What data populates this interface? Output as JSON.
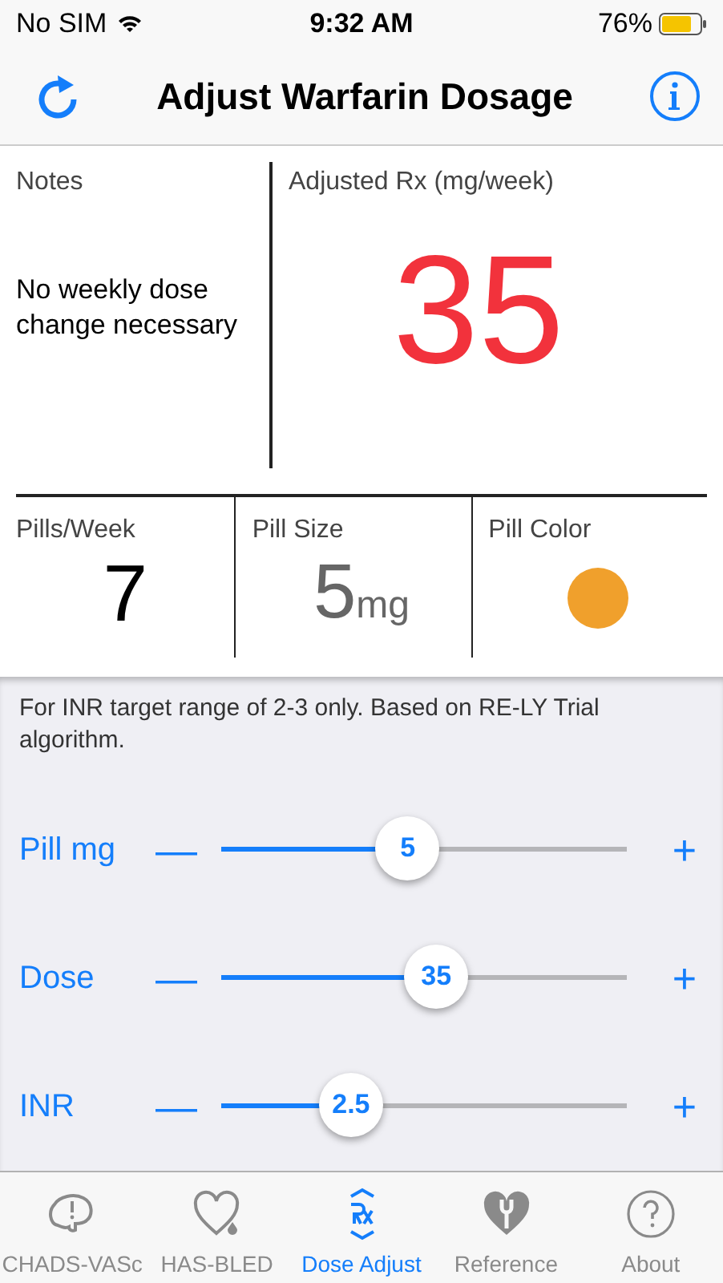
{
  "status_bar": {
    "carrier": "No SIM",
    "time": "9:32 AM",
    "battery": "76%"
  },
  "nav": {
    "title": "Adjust Warfarin Dosage"
  },
  "summary": {
    "notes_label": "Notes",
    "notes": "No weekly dose change necessary",
    "rx_label": "Adjusted Rx (mg/week)",
    "rx_value": "35"
  },
  "pill_stats": {
    "pills_label": "Pills/Week",
    "pills_value": "7",
    "size_label": "Pill Size",
    "size_value": "5",
    "size_unit": "mg",
    "color_label": "Pill Color",
    "color": "#f0a02c"
  },
  "note": "For INR target range of 2-3 only. Based on RE-LY Trial algorithm.",
  "sliders": [
    {
      "label": "Pill mg",
      "minus": "—",
      "plus": "+",
      "value": "5",
      "level": 0.46
    },
    {
      "label": "Dose",
      "minus": "—",
      "plus": "+",
      "value": "35",
      "level": 0.53
    },
    {
      "label": "INR",
      "minus": "—",
      "plus": "+",
      "value": "2.5",
      "level": 0.32
    }
  ],
  "tabs": [
    {
      "label": "CHADS-VASc",
      "selected": false
    },
    {
      "label": "HAS-BLED",
      "selected": false
    },
    {
      "label": "Dose Adjust",
      "selected": true
    },
    {
      "label": "Reference",
      "selected": false
    },
    {
      "label": "About",
      "selected": false
    }
  ]
}
